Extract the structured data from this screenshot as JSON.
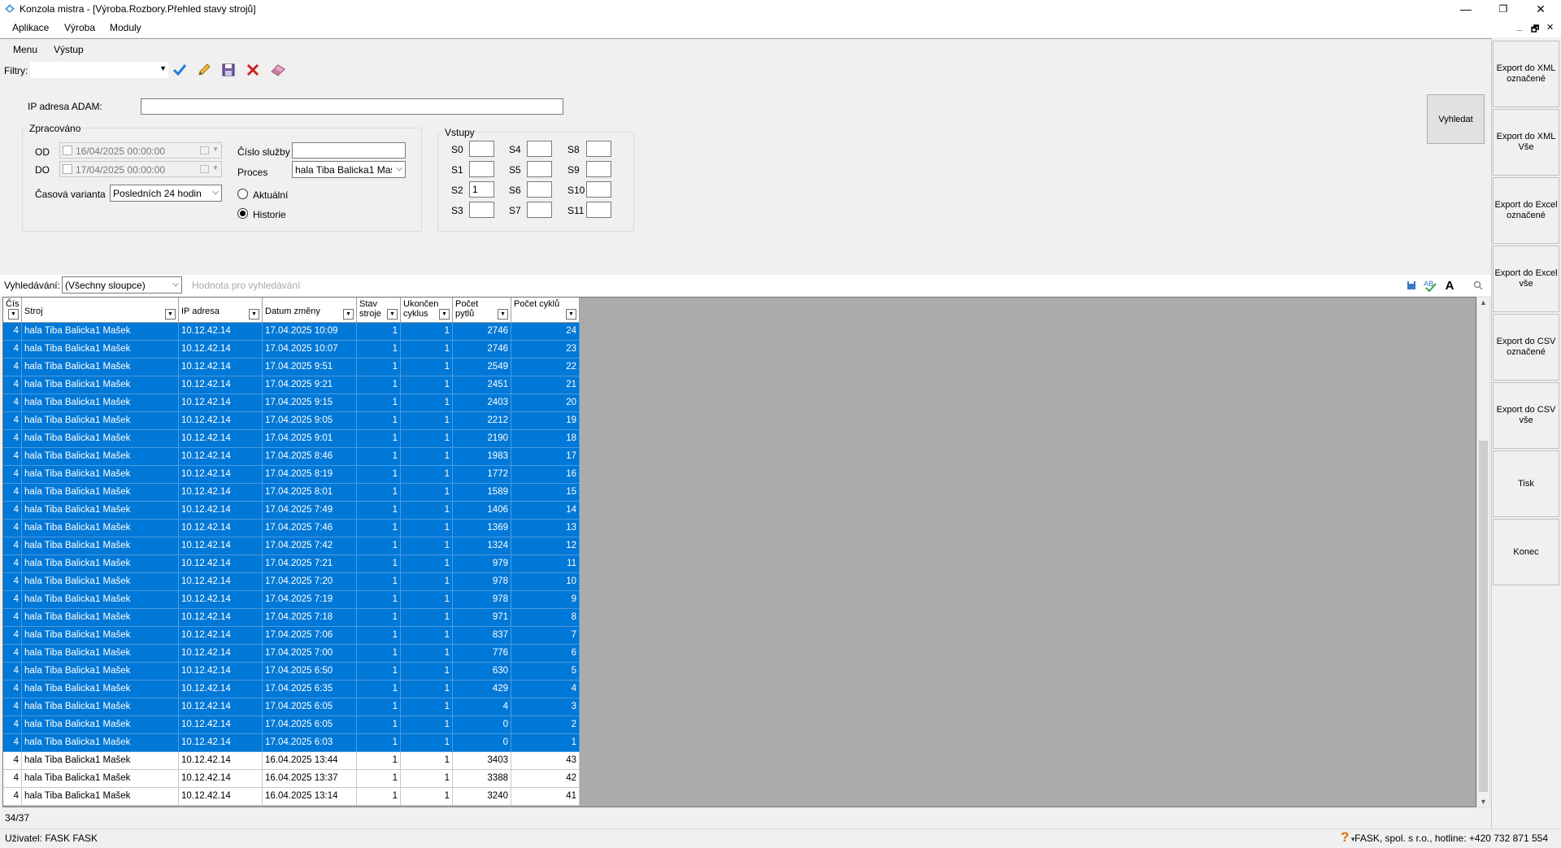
{
  "window": {
    "title": "Konzola mistra - [Výroba.Rozbory.Přehled stavy strojů]",
    "controls": [
      "—",
      "❐",
      "✕"
    ],
    "mdi_controls": [
      "_",
      "🗗",
      "✕"
    ]
  },
  "menubar": [
    "Aplikace",
    "Výroba",
    "Moduly"
  ],
  "inner_menu": [
    "Menu",
    "Výstup"
  ],
  "filters": {
    "label": "Filtry:",
    "value": ""
  },
  "form": {
    "ip_label": "IP adresa ADAM:",
    "ip_value": "",
    "processed_group": "Zpracováno",
    "od_label": "OD",
    "od_value": "16/04/2025 00:00:00",
    "do_label": "DO",
    "do_value": "17/04/2025 00:00:00",
    "time_variant_label": "Časová varianta",
    "time_variant_value": "Posledních 24 hodin",
    "service_no_label": "Číslo služby",
    "service_no_value": "",
    "process_label": "Proces",
    "process_value": "hala Tiba  Balicka1 Mašek",
    "radio_current": "Aktuální",
    "radio_history": "Historie",
    "radio_selected": "Historie",
    "inputs_group": "Vstupy",
    "inputs": [
      {
        "label": "S0",
        "value": ""
      },
      {
        "label": "S1",
        "value": ""
      },
      {
        "label": "S2",
        "value": "1"
      },
      {
        "label": "S3",
        "value": ""
      },
      {
        "label": "S4",
        "value": ""
      },
      {
        "label": "S5",
        "value": ""
      },
      {
        "label": "S6",
        "value": ""
      },
      {
        "label": "S7",
        "value": ""
      },
      {
        "label": "S8",
        "value": ""
      },
      {
        "label": "S9",
        "value": ""
      },
      {
        "label": "S10",
        "value": ""
      },
      {
        "label": "S11",
        "value": ""
      }
    ],
    "search_button": "Vyhledat"
  },
  "right_panel": [
    "Export do XML označené",
    "Export do XML Vše",
    "Export do Excel označené",
    "Export do Excel vše",
    "Export do CSV označené",
    "Export do CSV vše",
    "Tisk",
    "Konec"
  ],
  "search": {
    "label": "Vyhledávání:",
    "column_value": "(Všechny sloupce)",
    "placeholder": "Hodnota pro vyhledávání"
  },
  "grid": {
    "columns": [
      "Čís",
      "Stroj",
      "IP adresa",
      "Datum změny",
      "Stav stroje",
      "Ukončen cyklus",
      "Počet pytlů",
      "Počet cyklů"
    ],
    "rows": [
      {
        "c": "4",
        "stroj": "hala Tiba  Balicka1 Mašek",
        "ip": "10.12.42.14",
        "datum": "17.04.2025 10:09",
        "stav": "1",
        "ukon": "1",
        "pytlu": "2746",
        "cyklu": "24",
        "sel": true
      },
      {
        "c": "4",
        "stroj": "hala Tiba  Balicka1 Mašek",
        "ip": "10.12.42.14",
        "datum": "17.04.2025 10:07",
        "stav": "1",
        "ukon": "1",
        "pytlu": "2746",
        "cyklu": "23",
        "sel": true
      },
      {
        "c": "4",
        "stroj": "hala Tiba  Balicka1 Mašek",
        "ip": "10.12.42.14",
        "datum": "17.04.2025 9:51",
        "stav": "1",
        "ukon": "1",
        "pytlu": "2549",
        "cyklu": "22",
        "sel": true
      },
      {
        "c": "4",
        "stroj": "hala Tiba  Balicka1 Mašek",
        "ip": "10.12.42.14",
        "datum": "17.04.2025 9:21",
        "stav": "1",
        "ukon": "1",
        "pytlu": "2451",
        "cyklu": "21",
        "sel": true
      },
      {
        "c": "4",
        "stroj": "hala Tiba  Balicka1 Mašek",
        "ip": "10.12.42.14",
        "datum": "17.04.2025 9:15",
        "stav": "1",
        "ukon": "1",
        "pytlu": "2403",
        "cyklu": "20",
        "sel": true
      },
      {
        "c": "4",
        "stroj": "hala Tiba  Balicka1 Mašek",
        "ip": "10.12.42.14",
        "datum": "17.04.2025 9:05",
        "stav": "1",
        "ukon": "1",
        "pytlu": "2212",
        "cyklu": "19",
        "sel": true
      },
      {
        "c": "4",
        "stroj": "hala Tiba  Balicka1 Mašek",
        "ip": "10.12.42.14",
        "datum": "17.04.2025 9:01",
        "stav": "1",
        "ukon": "1",
        "pytlu": "2190",
        "cyklu": "18",
        "sel": true
      },
      {
        "c": "4",
        "stroj": "hala Tiba  Balicka1 Mašek",
        "ip": "10.12.42.14",
        "datum": "17.04.2025 8:46",
        "stav": "1",
        "ukon": "1",
        "pytlu": "1983",
        "cyklu": "17",
        "sel": true
      },
      {
        "c": "4",
        "stroj": "hala Tiba  Balicka1 Mašek",
        "ip": "10.12.42.14",
        "datum": "17.04.2025 8:19",
        "stav": "1",
        "ukon": "1",
        "pytlu": "1772",
        "cyklu": "16",
        "sel": true
      },
      {
        "c": "4",
        "stroj": "hala Tiba  Balicka1 Mašek",
        "ip": "10.12.42.14",
        "datum": "17.04.2025 8:01",
        "stav": "1",
        "ukon": "1",
        "pytlu": "1589",
        "cyklu": "15",
        "sel": true
      },
      {
        "c": "4",
        "stroj": "hala Tiba  Balicka1 Mašek",
        "ip": "10.12.42.14",
        "datum": "17.04.2025 7:49",
        "stav": "1",
        "ukon": "1",
        "pytlu": "1406",
        "cyklu": "14",
        "sel": true
      },
      {
        "c": "4",
        "stroj": "hala Tiba  Balicka1 Mašek",
        "ip": "10.12.42.14",
        "datum": "17.04.2025 7:46",
        "stav": "1",
        "ukon": "1",
        "pytlu": "1369",
        "cyklu": "13",
        "sel": true
      },
      {
        "c": "4",
        "stroj": "hala Tiba  Balicka1 Mašek",
        "ip": "10.12.42.14",
        "datum": "17.04.2025 7:42",
        "stav": "1",
        "ukon": "1",
        "pytlu": "1324",
        "cyklu": "12",
        "sel": true
      },
      {
        "c": "4",
        "stroj": "hala Tiba  Balicka1 Mašek",
        "ip": "10.12.42.14",
        "datum": "17.04.2025 7:21",
        "stav": "1",
        "ukon": "1",
        "pytlu": "979",
        "cyklu": "11",
        "sel": true
      },
      {
        "c": "4",
        "stroj": "hala Tiba  Balicka1 Mašek",
        "ip": "10.12.42.14",
        "datum": "17.04.2025 7:20",
        "stav": "1",
        "ukon": "1",
        "pytlu": "978",
        "cyklu": "10",
        "sel": true
      },
      {
        "c": "4",
        "stroj": "hala Tiba  Balicka1 Mašek",
        "ip": "10.12.42.14",
        "datum": "17.04.2025 7:19",
        "stav": "1",
        "ukon": "1",
        "pytlu": "978",
        "cyklu": "9",
        "sel": true
      },
      {
        "c": "4",
        "stroj": "hala Tiba  Balicka1 Mašek",
        "ip": "10.12.42.14",
        "datum": "17.04.2025 7:18",
        "stav": "1",
        "ukon": "1",
        "pytlu": "971",
        "cyklu": "8",
        "sel": true
      },
      {
        "c": "4",
        "stroj": "hala Tiba  Balicka1 Mašek",
        "ip": "10.12.42.14",
        "datum": "17.04.2025 7:06",
        "stav": "1",
        "ukon": "1",
        "pytlu": "837",
        "cyklu": "7",
        "sel": true
      },
      {
        "c": "4",
        "stroj": "hala Tiba  Balicka1 Mašek",
        "ip": "10.12.42.14",
        "datum": "17.04.2025 7:00",
        "stav": "1",
        "ukon": "1",
        "pytlu": "776",
        "cyklu": "6",
        "sel": true
      },
      {
        "c": "4",
        "stroj": "hala Tiba  Balicka1 Mašek",
        "ip": "10.12.42.14",
        "datum": "17.04.2025 6:50",
        "stav": "1",
        "ukon": "1",
        "pytlu": "630",
        "cyklu": "5",
        "sel": true
      },
      {
        "c": "4",
        "stroj": "hala Tiba  Balicka1 Mašek",
        "ip": "10.12.42.14",
        "datum": "17.04.2025 6:35",
        "stav": "1",
        "ukon": "1",
        "pytlu": "429",
        "cyklu": "4",
        "sel": true
      },
      {
        "c": "4",
        "stroj": "hala Tiba  Balicka1 Mašek",
        "ip": "10.12.42.14",
        "datum": "17.04.2025 6:05",
        "stav": "1",
        "ukon": "1",
        "pytlu": "4",
        "cyklu": "3",
        "sel": true
      },
      {
        "c": "4",
        "stroj": "hala Tiba  Balicka1 Mašek",
        "ip": "10.12.42.14",
        "datum": "17.04.2025 6:05",
        "stav": "1",
        "ukon": "1",
        "pytlu": "0",
        "cyklu": "2",
        "sel": true
      },
      {
        "c": "4",
        "stroj": "hala Tiba  Balicka1 Mašek",
        "ip": "10.12.42.14",
        "datum": "17.04.2025 6:03",
        "stav": "1",
        "ukon": "1",
        "pytlu": "0",
        "cyklu": "1",
        "sel": true
      },
      {
        "c": "4",
        "stroj": "hala Tiba  Balicka1 Mašek",
        "ip": "10.12.42.14",
        "datum": "16.04.2025 13:44",
        "stav": "1",
        "ukon": "1",
        "pytlu": "3403",
        "cyklu": "43",
        "sel": false
      },
      {
        "c": "4",
        "stroj": "hala Tiba  Balicka1 Mašek",
        "ip": "10.12.42.14",
        "datum": "16.04.2025 13:37",
        "stav": "1",
        "ukon": "1",
        "pytlu": "3388",
        "cyklu": "42",
        "sel": false
      },
      {
        "c": "4",
        "stroj": "hala Tiba  Balicka1 Mašek",
        "ip": "10.12.42.14",
        "datum": "16.04.2025 13:14",
        "stav": "1",
        "ukon": "1",
        "pytlu": "3240",
        "cyklu": "41",
        "sel": false
      }
    ]
  },
  "status": {
    "count": "34/37",
    "user": "Uživatel: FASK FASK",
    "hotline": "FASK, spol. s r.o., hotline: +420 732 871 554"
  },
  "colors": {
    "selection": "#0078d7",
    "grid_bg": "#ababab",
    "check_icon": "#1e7fd8",
    "delete_icon": "#d02020"
  }
}
